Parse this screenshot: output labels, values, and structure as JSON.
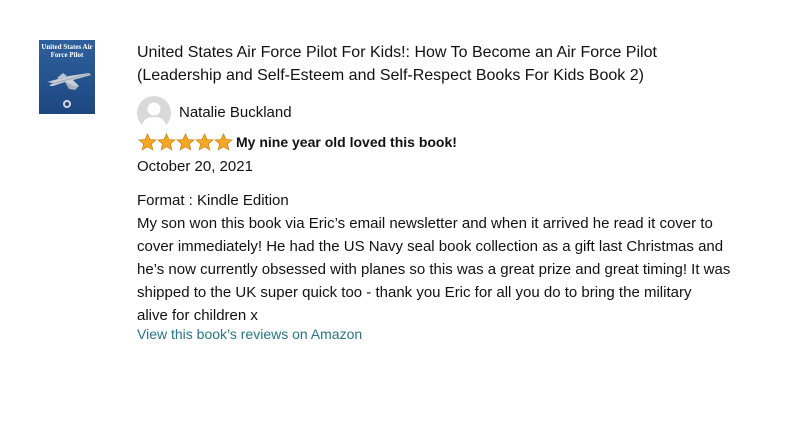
{
  "book": {
    "cover_title": "United States Air Force Pilot",
    "cover_colors": {
      "background": "#24538e",
      "text": "#ffffff"
    },
    "title_line1": "United States Air Force Pilot For Kids!: How To Become an Air Force Pilot",
    "title_line2": "(Leadership and Self-Esteem and Self-Respect Books For Kids Book 2)"
  },
  "review": {
    "reviewer_name": "Natalie Buckland",
    "avatar_icon": "user-avatar-icon",
    "rating": 5,
    "rating_max": 5,
    "star_color": "#f5a623",
    "headline": "My nine year old loved this book!",
    "date": "October 20, 2021",
    "format_label": "Format : Kindle Edition",
    "body_lines": [
      "My son won this book via Eric’s email newsletter and when it arrived he read it cover to",
      "cover immediately! He had the US Navy seal book collection as a gift last Christmas and",
      "he’s now currently obsessed with planes so this was a great prize and great timing! It was",
      "shipped to the UK super quick too - thank you Eric for all you do to bring the military",
      "alive for children x"
    ],
    "link_text": "View this book’s reviews on Amazon",
    "link_color": "#2a7384"
  }
}
